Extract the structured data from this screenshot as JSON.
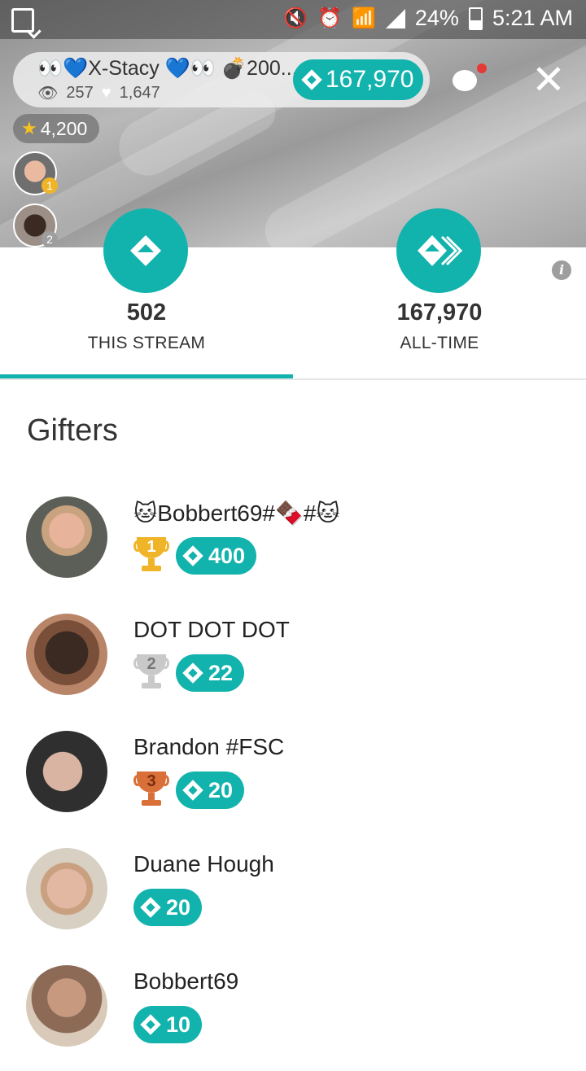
{
  "status_bar": {
    "battery": "24%",
    "time": "5:21 AM"
  },
  "host": {
    "name": "👀💙X-Stacy 💙👀 💣200...",
    "viewers": "257",
    "likes": "1,647",
    "coins": "167,970",
    "stars": "4,200"
  },
  "stats": {
    "this_stream_value": "502",
    "this_stream_label": "THIS STREAM",
    "all_time_value": "167,970",
    "all_time_label": "ALL-TIME",
    "active_tab": "THIS STREAM"
  },
  "gifters_title": "Gifters",
  "gifters": [
    {
      "name": "🐱Bobbert69#🍫#🐱",
      "rank": "1",
      "amount": "400"
    },
    {
      "name": "DOT DOT DOT",
      "rank": "2",
      "amount": "22"
    },
    {
      "name": "Brandon #FSC",
      "rank": "3",
      "amount": "20"
    },
    {
      "name": "Duane Hough",
      "rank": "",
      "amount": "20"
    },
    {
      "name": "Bobbert69",
      "rank": "",
      "amount": "10"
    }
  ],
  "top_gifter_ranks": [
    "1",
    "2"
  ],
  "colors": {
    "accent": "#13b3ad",
    "gold": "#f0b429",
    "silver": "#bdbdbd",
    "bronze": "#d9703a"
  }
}
